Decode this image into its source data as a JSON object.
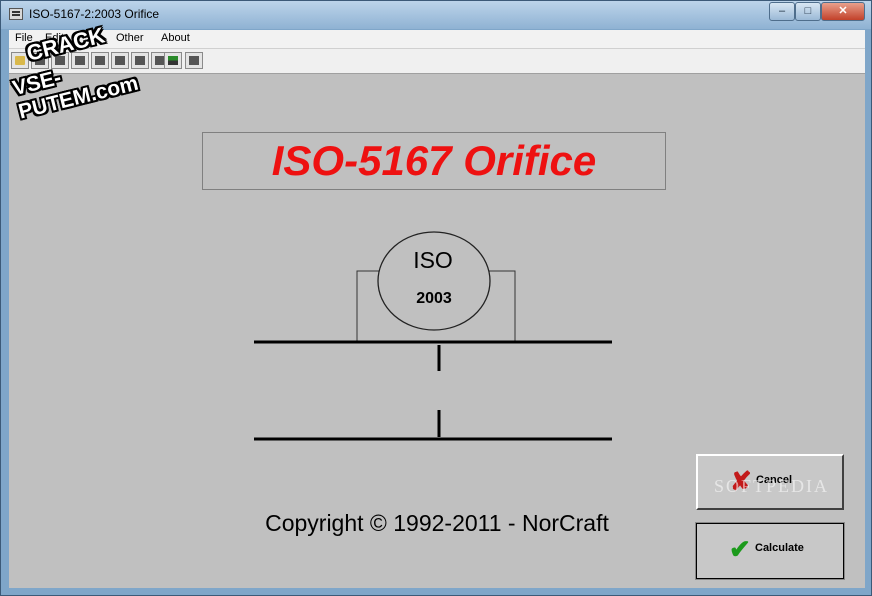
{
  "window": {
    "title": "ISO-5167-2:2003 Orifice"
  },
  "controls": {
    "minimize": "–",
    "maximize": "□",
    "close": "✕"
  },
  "menu": {
    "file": "File",
    "edit": "Edit",
    "other": "Other",
    "about": "About"
  },
  "toolbar": {
    "icons": [
      "open-folder-icon",
      "document-icon",
      "document-icon",
      "document-icon",
      "document-icon",
      "document-icon",
      "document-icon",
      "document-icon",
      "chart-icon",
      "save-icon"
    ]
  },
  "main": {
    "title": "ISO-5167 Orifice",
    "seal_top": "ISO",
    "seal_bottom": "2003",
    "copyright": "Copyright © 1992-2011 -  NorCraft"
  },
  "buttons": {
    "cancel": "Cancel",
    "calculate": "Calculate"
  },
  "watermark": {
    "text": "SOFTPEDIA"
  },
  "stamp": {
    "line1": "CRACK",
    "line2": "VSE-PUTEM.com"
  },
  "colors": {
    "title_red": "#ee1111",
    "client_bg": "#c0c0c0",
    "cancel_icon": "#c21a1a",
    "check_icon": "#1c9a1c"
  }
}
